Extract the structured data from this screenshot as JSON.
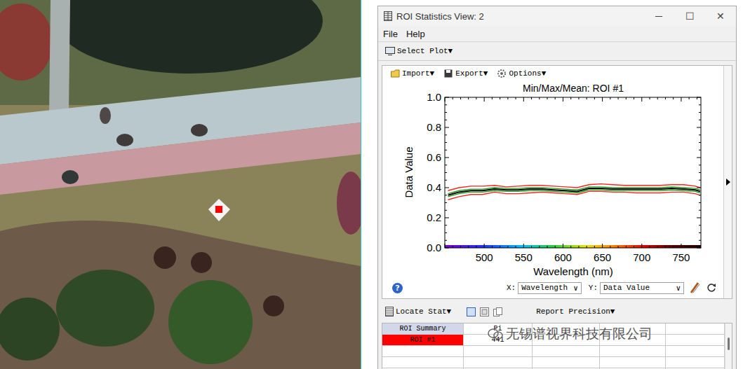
{
  "window": {
    "title": "ROI Statistics View: 2",
    "controls": [
      "─",
      "☐",
      "✕"
    ]
  },
  "menu": [
    "File",
    "Help"
  ],
  "toolbar": {
    "select_plot": "Select Plot▼"
  },
  "plot_toolbar": [
    "Import▼",
    "Export▼",
    "Options▼"
  ],
  "chart": {
    "title": "Min/Max/Mean: ROI #1",
    "y_label": "Data Value",
    "x_label": "Wavelength (nm)",
    "y_ticks": [
      "0.0",
      "0.2",
      "0.4",
      "0.6",
      "0.8",
      "1.0"
    ],
    "x_ticks": [
      "500",
      "550",
      "600",
      "650",
      "700",
      "750"
    ],
    "x_min": 450,
    "x_max": 775,
    "y_min": 0,
    "y_max": 1,
    "wavelengths": [
      454,
      468,
      483,
      498,
      513,
      528,
      543,
      558,
      573,
      588,
      603,
      618,
      633,
      648,
      663,
      678,
      693,
      708,
      723,
      738,
      753,
      768,
      774
    ],
    "series": [
      {
        "color": "#ff2020",
        "values": [
          0.38,
          0.4,
          0.41,
          0.41,
          0.415,
          0.405,
          0.41,
          0.415,
          0.415,
          0.41,
          0.405,
          0.4,
          0.42,
          0.425,
          0.42,
          0.415,
          0.415,
          0.415,
          0.415,
          0.42,
          0.42,
          0.41,
          0.4
        ]
      },
      {
        "color": "#ff2020",
        "values": [
          0.32,
          0.34,
          0.355,
          0.355,
          0.37,
          0.36,
          0.36,
          0.365,
          0.37,
          0.365,
          0.36,
          0.355,
          0.375,
          0.375,
          0.37,
          0.37,
          0.365,
          0.365,
          0.365,
          0.37,
          0.37,
          0.36,
          0.35
        ]
      },
      {
        "color": "#1fa01f",
        "values": [
          0.36,
          0.38,
          0.39,
          0.39,
          0.4,
          0.395,
          0.395,
          0.4,
          0.4,
          0.395,
          0.39,
          0.385,
          0.405,
          0.405,
          0.4,
          0.4,
          0.4,
          0.4,
          0.4,
          0.405,
          0.4,
          0.395,
          0.385
        ]
      },
      {
        "color": "#1fa01f",
        "values": [
          0.34,
          0.36,
          0.37,
          0.37,
          0.38,
          0.375,
          0.375,
          0.38,
          0.38,
          0.375,
          0.37,
          0.365,
          0.385,
          0.385,
          0.38,
          0.38,
          0.38,
          0.38,
          0.38,
          0.385,
          0.38,
          0.375,
          0.365
        ]
      },
      {
        "color": "#000000",
        "values": [
          0.35,
          0.37,
          0.38,
          0.38,
          0.39,
          0.385,
          0.385,
          0.39,
          0.39,
          0.385,
          0.38,
          0.375,
          0.395,
          0.395,
          0.39,
          0.39,
          0.39,
          0.39,
          0.39,
          0.395,
          0.39,
          0.385,
          0.375
        ]
      }
    ]
  },
  "axis_selectors": {
    "help": "?",
    "x_label": "X:",
    "x_value": "Wavelength",
    "y_label": "Y:",
    "y_value": "Data Value",
    "arrow": "∨"
  },
  "stats_toolbar": {
    "locate": "Locate Stat▼",
    "precision": "Report Precision▼"
  },
  "table": {
    "columns": [
      "ROI Summary",
      "Pi"
    ],
    "rows": [
      {
        "cells": [
          "ROI #1",
          "441"
        ],
        "color": "#ff0000"
      }
    ]
  },
  "watermark": "无锡谱视界科技有限公司"
}
